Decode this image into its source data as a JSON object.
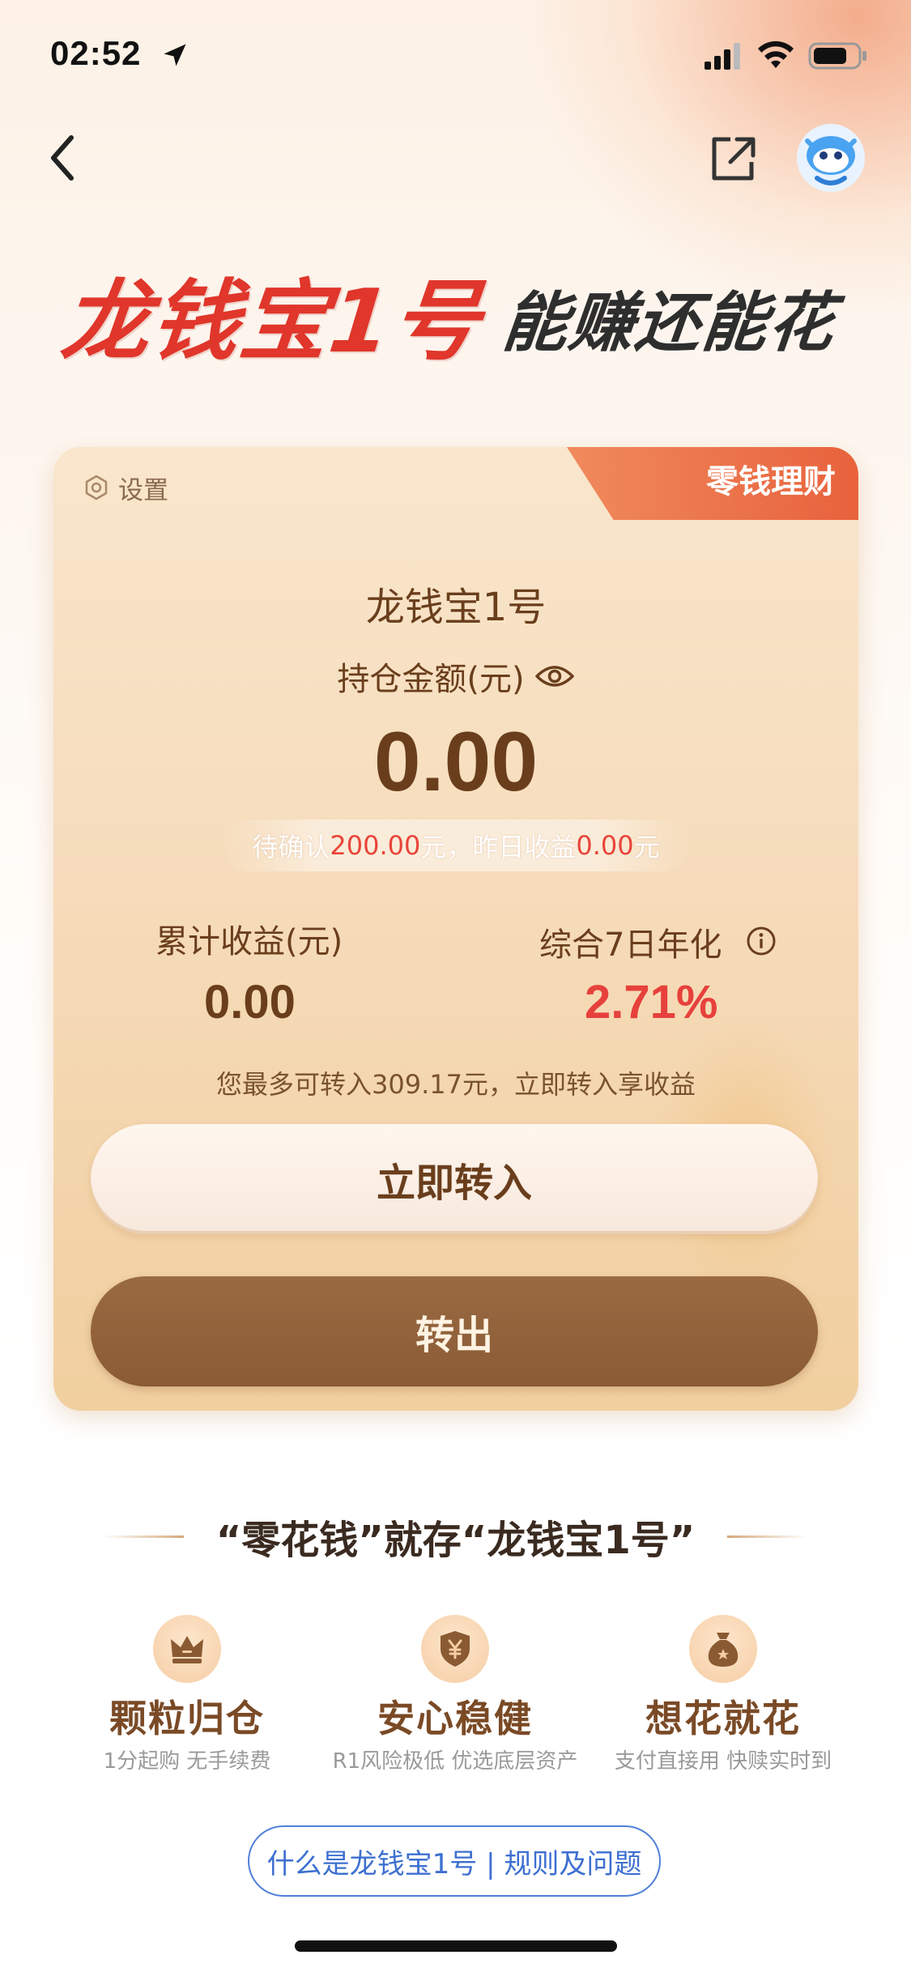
{
  "status_bar": {
    "time": "02:52"
  },
  "banner": {
    "title": "龙钱宝1号",
    "subtitle": "能赚还能花"
  },
  "card": {
    "tag": "零钱理财",
    "settings_label": "设置",
    "product_name": "龙钱宝1号",
    "holding_label": "持仓金额(元)",
    "holding_amount": "0.00",
    "pending": {
      "prefix": "待确认",
      "pending_amount": "200.00",
      "mid": "元，昨日收益",
      "yesterday_income": "0.00",
      "suffix": "元"
    },
    "cumulative_label": "累计收益(元)",
    "cumulative_value": "0.00",
    "yield_label": "综合7日年化",
    "yield_value": "2.71%",
    "hint": "您最多可转入309.17元，立即转入享收益",
    "btn_in": "立即转入",
    "btn_out": "转出"
  },
  "section": {
    "title": "“零花钱”就存“龙钱宝1号”",
    "features": [
      {
        "icon": "crown-icon",
        "title": "颗粒归仓",
        "desc": "1分起购 无手续费"
      },
      {
        "icon": "shield-yen-icon",
        "title": "安心稳健",
        "desc": "R1风险极低 优选底层资产"
      },
      {
        "icon": "money-bag-icon",
        "title": "想花就花",
        "desc": "支付直接用 快赎实时到"
      }
    ],
    "link": "什么是龙钱宝1号 | 规则及问题"
  },
  "colors": {
    "accent_red": "#e6413c",
    "brown": "#6a3e1c",
    "link_blue": "#3d6fd0"
  }
}
